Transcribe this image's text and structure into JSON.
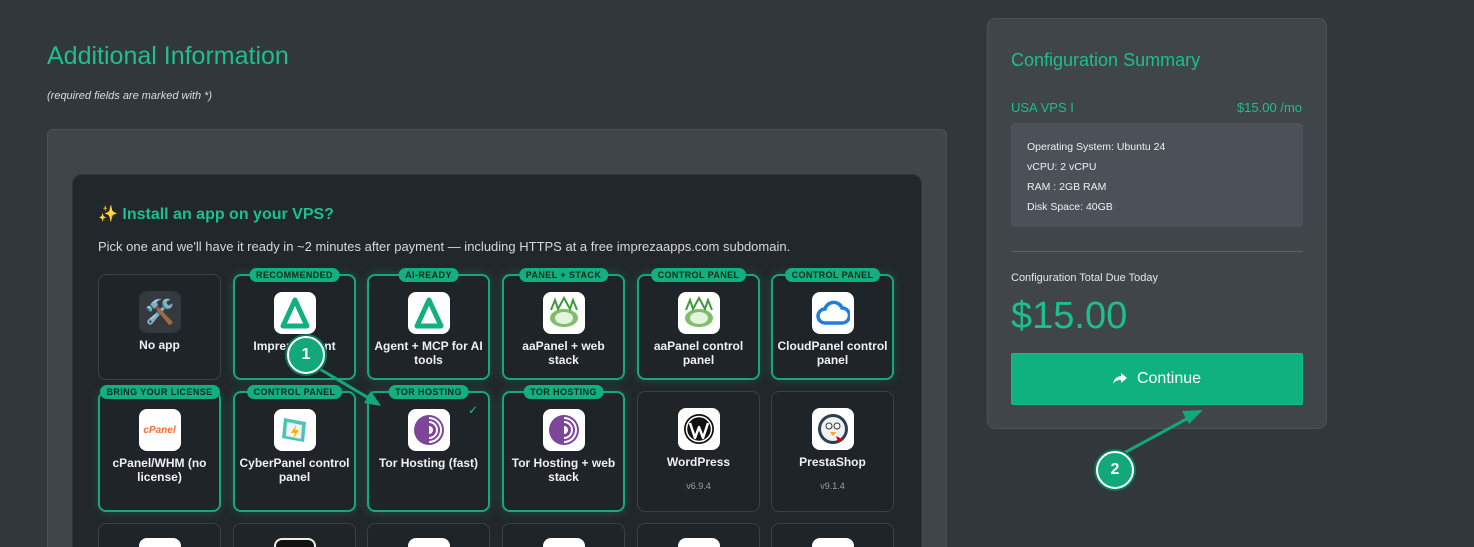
{
  "page": {
    "title": "Additional Information",
    "required_note": "(required fields are marked with *)"
  },
  "install": {
    "title": "✨ Install an app on your VPS?",
    "subtitle": "Pick one and we'll have it ready in ~2 minutes after payment — including HTTPS at a free imprezaapps.com subdomain.",
    "apps": [
      {
        "name": "No app",
        "badge": "",
        "icon": "tools-icon"
      },
      {
        "name": "Impreza Agent",
        "badge": "RECOMMENDED",
        "icon": "delta-icon"
      },
      {
        "name": "Agent + MCP for AI tools",
        "badge": "AI-READY",
        "icon": "delta-icon"
      },
      {
        "name": "aaPanel + web stack",
        "badge": "PANEL + STACK",
        "icon": "aapanel-icon"
      },
      {
        "name": "aaPanel control panel",
        "badge": "CONTROL PANEL",
        "icon": "aapanel-icon"
      },
      {
        "name": "CloudPanel control panel",
        "badge": "CONTROL PANEL",
        "icon": "cloudpanel-icon"
      },
      {
        "name": "cPanel/WHM (no license)",
        "badge": "BRING YOUR LICENSE",
        "icon": "cpanel-icon"
      },
      {
        "name": "CyberPanel control panel",
        "badge": "CONTROL PANEL",
        "icon": "cyberpanel-icon"
      },
      {
        "name": "Tor Hosting (fast)",
        "badge": "TOR HOSTING",
        "icon": "tor-icon",
        "selected": true
      },
      {
        "name": "Tor Hosting + web stack",
        "badge": "TOR HOSTING",
        "icon": "tor-icon"
      },
      {
        "name": "WordPress",
        "badge": "",
        "icon": "wordpress-icon",
        "version": "v6.9.4"
      },
      {
        "name": "PrestaShop",
        "badge": "",
        "icon": "prestashop-icon",
        "version": "v9.1.4"
      }
    ],
    "selected_check": "✓",
    "cpanel_logo_text": "cPanel"
  },
  "summary": {
    "title": "Configuration Summary",
    "plan_name": "USA VPS I",
    "plan_price": "$15.00 /mo",
    "specs": [
      "Operating System: Ubuntu 24",
      "vCPU: 2 vCPU",
      "RAM : 2GB RAM",
      "Disk Space: 40GB"
    ],
    "total_label": "Configuration Total Due Today",
    "total_amount": "$15.00",
    "continue_label": "Continue",
    "continue_icon": "share-arrow-icon"
  },
  "annotations": {
    "marker_1": "1",
    "marker_2": "2",
    "color": "#12a878"
  },
  "colors": {
    "accent": "#1dbf8e",
    "background": "#32373b",
    "button": "#0fb27e"
  }
}
